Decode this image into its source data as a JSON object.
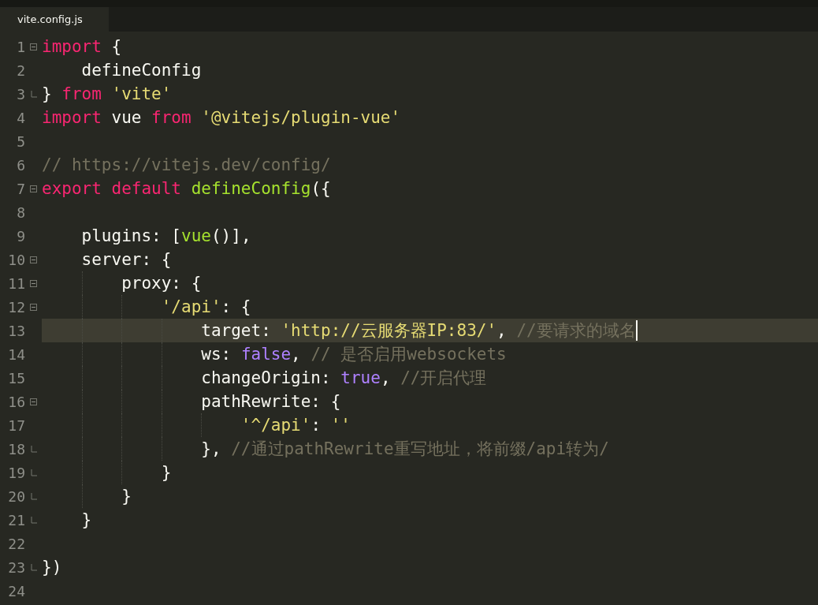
{
  "tabs": [
    {
      "label": "vite.config.js",
      "selected": true
    }
  ],
  "lines": [
    {
      "number": "1",
      "fold_start": true,
      "fold_end": false,
      "current": false,
      "tokens": [
        {
          "kind": "keyword",
          "text": "import"
        },
        {
          "kind": "plain",
          "text": " {"
        }
      ]
    },
    {
      "number": "2",
      "fold_start": false,
      "fold_end": false,
      "current": false,
      "tokens": [
        {
          "kind": "plain",
          "text": "    defineConfig"
        }
      ]
    },
    {
      "number": "3",
      "fold_start": false,
      "fold_end": true,
      "current": false,
      "tokens": [
        {
          "kind": "plain",
          "text": "} "
        },
        {
          "kind": "keyword",
          "text": "from"
        },
        {
          "kind": "string",
          "text": " 'vite'"
        }
      ]
    },
    {
      "number": "4",
      "fold_start": false,
      "fold_end": false,
      "current": false,
      "tokens": [
        {
          "kind": "keyword",
          "text": "import"
        },
        {
          "kind": "plain",
          "text": " vue "
        },
        {
          "kind": "keyword",
          "text": "from"
        },
        {
          "kind": "string",
          "text": " '@vitejs/plugin-vue'"
        }
      ]
    },
    {
      "number": "5",
      "fold_start": false,
      "fold_end": false,
      "current": false
    },
    {
      "number": "6",
      "fold_start": false,
      "fold_end": false,
      "current": false,
      "tokens": [
        {
          "kind": "comment",
          "text": "// https://vitejs.dev/config/"
        }
      ]
    },
    {
      "number": "7",
      "fold_start": true,
      "fold_end": false,
      "current": false,
      "tokens": [
        {
          "kind": "keyword",
          "text": "export"
        },
        {
          "kind": "keyword",
          "text": " default"
        },
        {
          "kind": "function",
          "text": " defineConfig"
        },
        {
          "kind": "plain",
          "text": "({"
        }
      ]
    },
    {
      "number": "8",
      "fold_start": false,
      "fold_end": false,
      "current": false
    },
    {
      "number": "9",
      "fold_start": false,
      "fold_end": false,
      "current": false,
      "tokens": [
        {
          "kind": "plain",
          "text": "    plugins: ["
        },
        {
          "kind": "function",
          "text": "vue"
        },
        {
          "kind": "plain",
          "text": "()],"
        }
      ]
    },
    {
      "number": "10",
      "fold_start": true,
      "fold_end": false,
      "current": false,
      "tokens": [
        {
          "kind": "plain",
          "text": "    server: {"
        }
      ]
    },
    {
      "number": "11",
      "fold_start": true,
      "fold_end": false,
      "current": false,
      "tokens": [
        {
          "kind": "plain",
          "text": "        proxy: {"
        }
      ]
    },
    {
      "number": "12",
      "fold_start": true,
      "fold_end": false,
      "current": false,
      "tokens": [
        {
          "kind": "string",
          "text": "            '/api'"
        },
        {
          "kind": "plain",
          "text": ": {"
        }
      ]
    },
    {
      "number": "13",
      "fold_start": false,
      "fold_end": false,
      "current": true,
      "tokens": [
        {
          "kind": "plain",
          "text": "                target: "
        },
        {
          "kind": "string",
          "text": "'http://云服务器IP:83/'"
        },
        {
          "kind": "plain",
          "text": ", "
        },
        {
          "kind": "comment",
          "text": "//要请求的域名"
        }
      ]
    },
    {
      "number": "14",
      "fold_start": false,
      "fold_end": false,
      "current": false,
      "tokens": [
        {
          "kind": "plain",
          "text": "                ws: "
        },
        {
          "kind": "constant",
          "text": "false"
        },
        {
          "kind": "plain",
          "text": ", "
        },
        {
          "kind": "comment",
          "text": "// 是否启用websockets"
        }
      ]
    },
    {
      "number": "15",
      "fold_start": false,
      "fold_end": false,
      "current": false,
      "tokens": [
        {
          "kind": "plain",
          "text": "                changeOrigin: "
        },
        {
          "kind": "constant",
          "text": "true"
        },
        {
          "kind": "plain",
          "text": ", "
        },
        {
          "kind": "comment",
          "text": "//开启代理"
        }
      ]
    },
    {
      "number": "16",
      "fold_start": true,
      "fold_end": false,
      "current": false,
      "tokens": [
        {
          "kind": "plain",
          "text": "                pathRewrite: {"
        }
      ]
    },
    {
      "number": "17",
      "fold_start": false,
      "fold_end": false,
      "current": false,
      "tokens": [
        {
          "kind": "string",
          "text": "                    '^/api'"
        },
        {
          "kind": "plain",
          "text": ": "
        },
        {
          "kind": "string",
          "text": "''"
        }
      ]
    },
    {
      "number": "18",
      "fold_start": false,
      "fold_end": true,
      "current": false,
      "tokens": [
        {
          "kind": "plain",
          "text": "                }, "
        },
        {
          "kind": "comment",
          "text": "//通过pathRewrite重写地址，将前缀/api转为/"
        }
      ]
    },
    {
      "number": "19",
      "fold_start": false,
      "fold_end": true,
      "current": false,
      "tokens": [
        {
          "kind": "plain",
          "text": "            }"
        }
      ]
    },
    {
      "number": "20",
      "fold_start": false,
      "fold_end": true,
      "current": false,
      "tokens": [
        {
          "kind": "plain",
          "text": "        }"
        }
      ]
    },
    {
      "number": "21",
      "fold_start": false,
      "fold_end": true,
      "current": false,
      "tokens": [
        {
          "kind": "plain",
          "text": "    }"
        }
      ]
    },
    {
      "number": "22",
      "fold_start": false,
      "fold_end": false,
      "current": false
    },
    {
      "number": "23",
      "fold_start": false,
      "fold_end": true,
      "current": false,
      "tokens": [
        {
          "kind": "plain",
          "text": "})"
        }
      ]
    },
    {
      "number": "24",
      "fold_start": false,
      "fold_end": false,
      "current": false
    }
  ]
}
